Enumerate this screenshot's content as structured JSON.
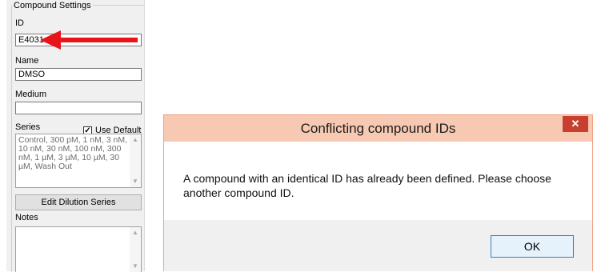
{
  "compound_settings": {
    "group_title": "Compound Settings",
    "id_label": "ID",
    "id_value": "E4031",
    "name_label": "Name",
    "name_value": "DMSO",
    "medium_label": "Medium",
    "medium_value": "",
    "series_label": "Series",
    "use_default_label": "Use Default",
    "use_default_checked": true,
    "series_value": "Control, 300 pM, 1 nM, 3 nM, 10 nM, 30 nM, 100 nM, 300 nM, 1 µM, 3 µM, 10 µM, 30 µM, Wash Out",
    "edit_button": "Edit Dilution Series",
    "notes_label": "Notes",
    "notes_value": ""
  },
  "annotation": {
    "arrow_color": "#e8141a"
  },
  "dialog": {
    "title": "Conflicting compound IDs",
    "close_glyph": "✕",
    "message": "A compound with an identical ID has already been defined. Please choose another compound ID.",
    "ok_label": "OK"
  }
}
